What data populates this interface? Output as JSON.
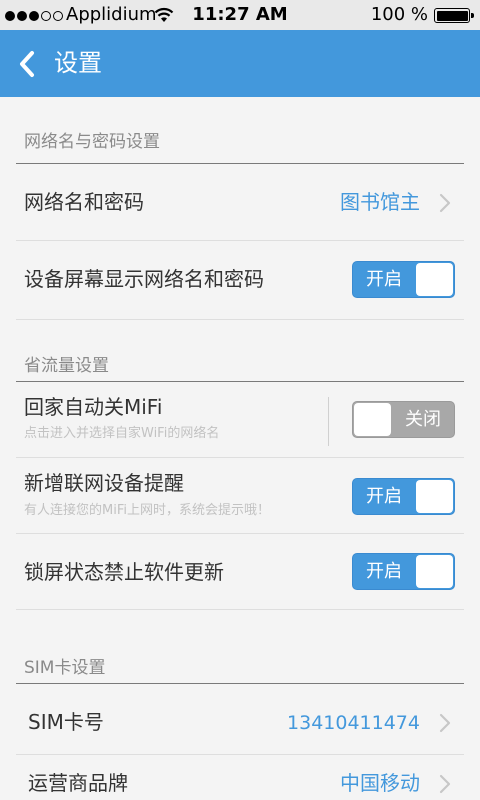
{
  "status_bar": {
    "carrier": "Applidium",
    "time": "11:27 AM",
    "battery": "100 %",
    "icons": [
      "signal-icon",
      "wifi-icon",
      "battery-icon"
    ]
  },
  "navbar": {
    "back_icon": "chevron-left-icon",
    "title": "设置"
  },
  "sections": {
    "wifi": {
      "header": "网络名与密码设置",
      "ssid_label": "网络名和密码",
      "ssid_value": "图书馆主",
      "show_on_screen_label": "设备屏幕显示网络名和密码",
      "show_on_screen_toggle": "开启"
    },
    "data_saving": {
      "header": "省流量设置",
      "auto_off_label": "回家自动关MiFi",
      "auto_off_sub": "点击进入并选择自家WiFi的网络名",
      "auto_off_toggle": "关闭",
      "new_device_label": "新增联网设备提醒",
      "new_device_sub": "有人连接您的MiFi上网时，系统会提示哦！",
      "new_device_toggle": "开启",
      "lock_update_label": "锁屏状态禁止软件更新",
      "lock_update_toggle": "开启"
    },
    "sim": {
      "header": "SIM卡设置",
      "sim_number_label": "SIM卡号",
      "sim_number_value": "13410411474",
      "carrier_label": "运营商品牌",
      "carrier_value": "中国移动"
    }
  },
  "colors": {
    "accent": "#4398dc",
    "toggle_off": "#a8a8a8",
    "background": "#f4f4f4"
  }
}
